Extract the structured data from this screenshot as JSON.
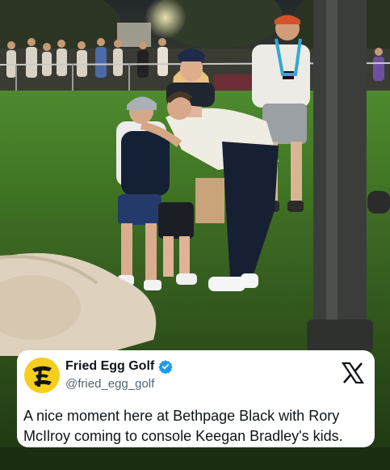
{
  "tweet": {
    "display_name": "Fried Egg Golf",
    "handle": "@fried_egg_golf",
    "verified_icon": "verified-badge-icon",
    "platform_icon": "x-logo-icon",
    "text": "A nice moment here at Bethpage Black with Rory McIlroy coming to console Keegan Bradley's kids."
  },
  "colors": {
    "avatar_bg": "#f4cf1c",
    "verified": "#1d9bf0",
    "grass": "#3f6f24",
    "card_bg": "#ffffff"
  }
}
